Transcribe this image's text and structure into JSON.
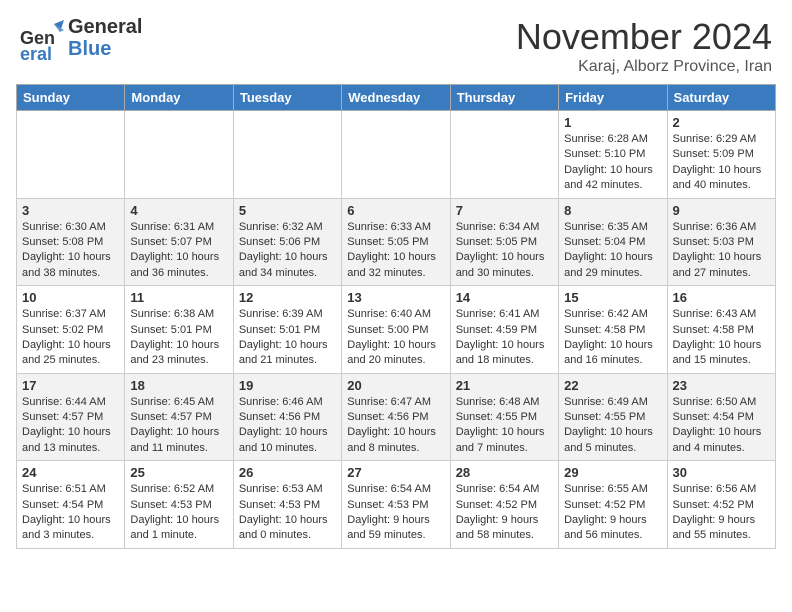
{
  "header": {
    "logo_general": "General",
    "logo_blue": "Blue",
    "month_title": "November 2024",
    "location": "Karaj, Alborz Province, Iran"
  },
  "days_of_week": [
    "Sunday",
    "Monday",
    "Tuesday",
    "Wednesday",
    "Thursday",
    "Friday",
    "Saturday"
  ],
  "weeks": [
    [
      {
        "day": "",
        "info": ""
      },
      {
        "day": "",
        "info": ""
      },
      {
        "day": "",
        "info": ""
      },
      {
        "day": "",
        "info": ""
      },
      {
        "day": "",
        "info": ""
      },
      {
        "day": "1",
        "info": "Sunrise: 6:28 AM\nSunset: 5:10 PM\nDaylight: 10 hours and 42 minutes."
      },
      {
        "day": "2",
        "info": "Sunrise: 6:29 AM\nSunset: 5:09 PM\nDaylight: 10 hours and 40 minutes."
      }
    ],
    [
      {
        "day": "3",
        "info": "Sunrise: 6:30 AM\nSunset: 5:08 PM\nDaylight: 10 hours and 38 minutes."
      },
      {
        "day": "4",
        "info": "Sunrise: 6:31 AM\nSunset: 5:07 PM\nDaylight: 10 hours and 36 minutes."
      },
      {
        "day": "5",
        "info": "Sunrise: 6:32 AM\nSunset: 5:06 PM\nDaylight: 10 hours and 34 minutes."
      },
      {
        "day": "6",
        "info": "Sunrise: 6:33 AM\nSunset: 5:05 PM\nDaylight: 10 hours and 32 minutes."
      },
      {
        "day": "7",
        "info": "Sunrise: 6:34 AM\nSunset: 5:05 PM\nDaylight: 10 hours and 30 minutes."
      },
      {
        "day": "8",
        "info": "Sunrise: 6:35 AM\nSunset: 5:04 PM\nDaylight: 10 hours and 29 minutes."
      },
      {
        "day": "9",
        "info": "Sunrise: 6:36 AM\nSunset: 5:03 PM\nDaylight: 10 hours and 27 minutes."
      }
    ],
    [
      {
        "day": "10",
        "info": "Sunrise: 6:37 AM\nSunset: 5:02 PM\nDaylight: 10 hours and 25 minutes."
      },
      {
        "day": "11",
        "info": "Sunrise: 6:38 AM\nSunset: 5:01 PM\nDaylight: 10 hours and 23 minutes."
      },
      {
        "day": "12",
        "info": "Sunrise: 6:39 AM\nSunset: 5:01 PM\nDaylight: 10 hours and 21 minutes."
      },
      {
        "day": "13",
        "info": "Sunrise: 6:40 AM\nSunset: 5:00 PM\nDaylight: 10 hours and 20 minutes."
      },
      {
        "day": "14",
        "info": "Sunrise: 6:41 AM\nSunset: 4:59 PM\nDaylight: 10 hours and 18 minutes."
      },
      {
        "day": "15",
        "info": "Sunrise: 6:42 AM\nSunset: 4:58 PM\nDaylight: 10 hours and 16 minutes."
      },
      {
        "day": "16",
        "info": "Sunrise: 6:43 AM\nSunset: 4:58 PM\nDaylight: 10 hours and 15 minutes."
      }
    ],
    [
      {
        "day": "17",
        "info": "Sunrise: 6:44 AM\nSunset: 4:57 PM\nDaylight: 10 hours and 13 minutes."
      },
      {
        "day": "18",
        "info": "Sunrise: 6:45 AM\nSunset: 4:57 PM\nDaylight: 10 hours and 11 minutes."
      },
      {
        "day": "19",
        "info": "Sunrise: 6:46 AM\nSunset: 4:56 PM\nDaylight: 10 hours and 10 minutes."
      },
      {
        "day": "20",
        "info": "Sunrise: 6:47 AM\nSunset: 4:56 PM\nDaylight: 10 hours and 8 minutes."
      },
      {
        "day": "21",
        "info": "Sunrise: 6:48 AM\nSunset: 4:55 PM\nDaylight: 10 hours and 7 minutes."
      },
      {
        "day": "22",
        "info": "Sunrise: 6:49 AM\nSunset: 4:55 PM\nDaylight: 10 hours and 5 minutes."
      },
      {
        "day": "23",
        "info": "Sunrise: 6:50 AM\nSunset: 4:54 PM\nDaylight: 10 hours and 4 minutes."
      }
    ],
    [
      {
        "day": "24",
        "info": "Sunrise: 6:51 AM\nSunset: 4:54 PM\nDaylight: 10 hours and 3 minutes."
      },
      {
        "day": "25",
        "info": "Sunrise: 6:52 AM\nSunset: 4:53 PM\nDaylight: 10 hours and 1 minute."
      },
      {
        "day": "26",
        "info": "Sunrise: 6:53 AM\nSunset: 4:53 PM\nDaylight: 10 hours and 0 minutes."
      },
      {
        "day": "27",
        "info": "Sunrise: 6:54 AM\nSunset: 4:53 PM\nDaylight: 9 hours and 59 minutes."
      },
      {
        "day": "28",
        "info": "Sunrise: 6:54 AM\nSunset: 4:52 PM\nDaylight: 9 hours and 58 minutes."
      },
      {
        "day": "29",
        "info": "Sunrise: 6:55 AM\nSunset: 4:52 PM\nDaylight: 9 hours and 56 minutes."
      },
      {
        "day": "30",
        "info": "Sunrise: 6:56 AM\nSunset: 4:52 PM\nDaylight: 9 hours and 55 minutes."
      }
    ]
  ]
}
